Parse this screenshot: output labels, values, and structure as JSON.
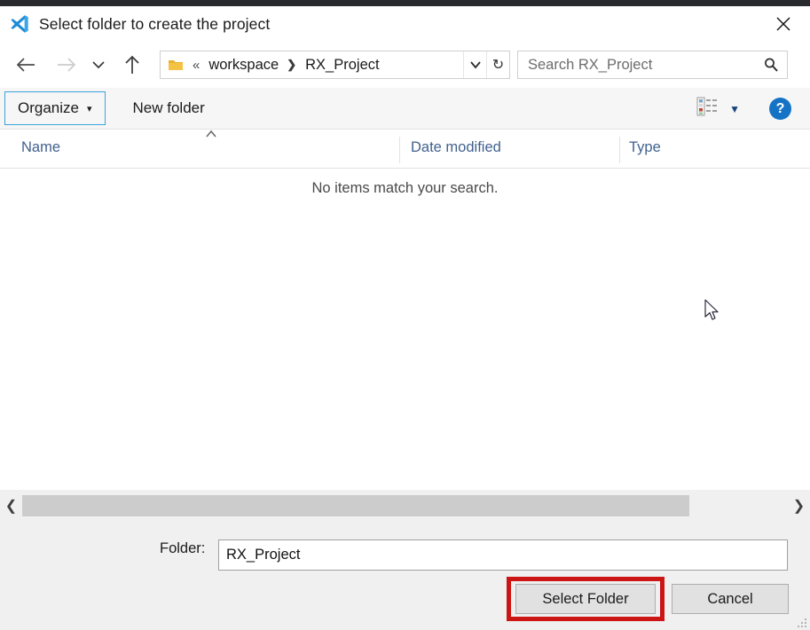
{
  "window": {
    "title": "Select folder to create the project",
    "app_icon": "vscode-icon",
    "close_label": "✕"
  },
  "navigation": {
    "back_icon": "back-arrow-icon",
    "forward_icon": "forward-arrow-icon",
    "recent_icon": "recent-locations-chevron-icon",
    "up_icon": "up-arrow-icon",
    "address": {
      "folder_icon": "folder-icon",
      "overflow": "«",
      "separator": "❯",
      "crumbs": [
        "workspace",
        "RX_Project"
      ],
      "dropdown_icon": "chevron-down-icon",
      "refresh_icon": "↻"
    },
    "search": {
      "placeholder": "Search RX_Project",
      "value": "",
      "icon": "search-icon"
    }
  },
  "toolbar": {
    "organize_label": "Organize",
    "organize_caret": "▾",
    "new_folder_label": "New folder",
    "view_icon": "details-view-icon",
    "view_caret": "▼",
    "help_label": "?"
  },
  "columns": {
    "sort_caret": "⌃",
    "headers": [
      "Name",
      "Date modified",
      "Type"
    ]
  },
  "filelist": {
    "empty_message": "No items match your search."
  },
  "scrollbar": {
    "left_arrow": "❮",
    "right_arrow": "❯"
  },
  "folder_field": {
    "label": "Folder:",
    "value": "RX_Project",
    "placeholder": ""
  },
  "footer": {
    "select_label": "Select Folder",
    "cancel_label": "Cancel",
    "highlight_color": "#cc1515"
  }
}
